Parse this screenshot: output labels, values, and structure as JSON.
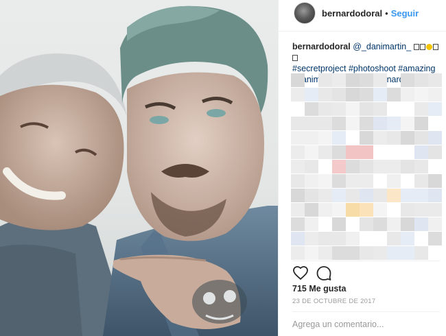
{
  "post": {
    "username": "bernardodoral",
    "separator": "•",
    "follow_label": "Seguir",
    "photo_alt": "Selfie of two men"
  },
  "caption": {
    "username": "bernardodoral",
    "mention": "@_danimartin_",
    "hashtags_line1": "#secretproject #photoshoot #amazing",
    "hashtags_line2": "#danimartin #lomas #bernardodoral"
  },
  "actions": {
    "like_icon": "heart-icon",
    "comment_icon": "comment-bubble-icon"
  },
  "likes_text": "715 Me gusta",
  "date_text": "23 DE OCTUBRE DE 2017",
  "comment_placeholder": "Agrega un comentario...",
  "colors": {
    "link": "#003569",
    "follow": "#3897f0",
    "muted": "#999999",
    "text": "#262626"
  }
}
